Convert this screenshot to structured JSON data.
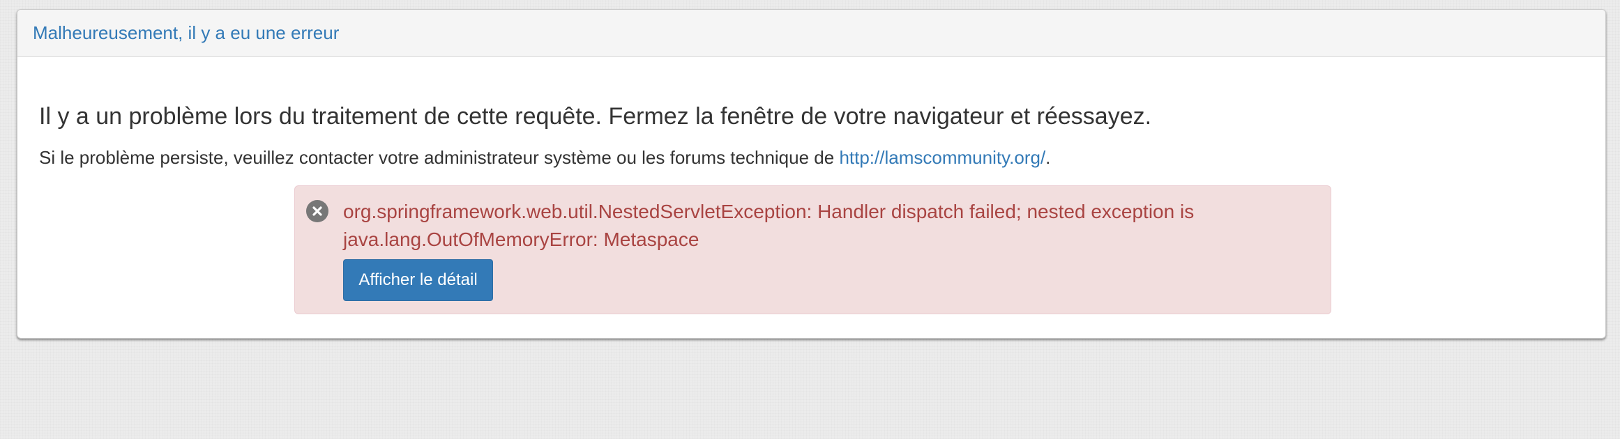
{
  "panel": {
    "title": "Malheureusement, il y a eu une erreur"
  },
  "body": {
    "main_message": "Il y a un problème lors du traitement de cette requête. Fermez la fenêtre de votre navigateur et réessayez.",
    "sub_message_prefix": "Si le problème persiste, veuillez contacter votre administrateur système ou les forums technique de ",
    "community_link_text": "http://lamscommunity.org/",
    "sub_message_suffix": "."
  },
  "alert": {
    "icon": "error-circle-x-icon",
    "message_line1": "org.springframework.web.util.NestedServletException: Handler dispatch failed; nested exception is",
    "message_line2": "java.lang.OutOfMemoryError: Metaspace",
    "detail_button_label": "Afficher le détail"
  },
  "colors": {
    "link": "#337ab7",
    "alert_background": "#f2dede",
    "alert_text": "#a94442",
    "button_primary": "#337ab7"
  }
}
